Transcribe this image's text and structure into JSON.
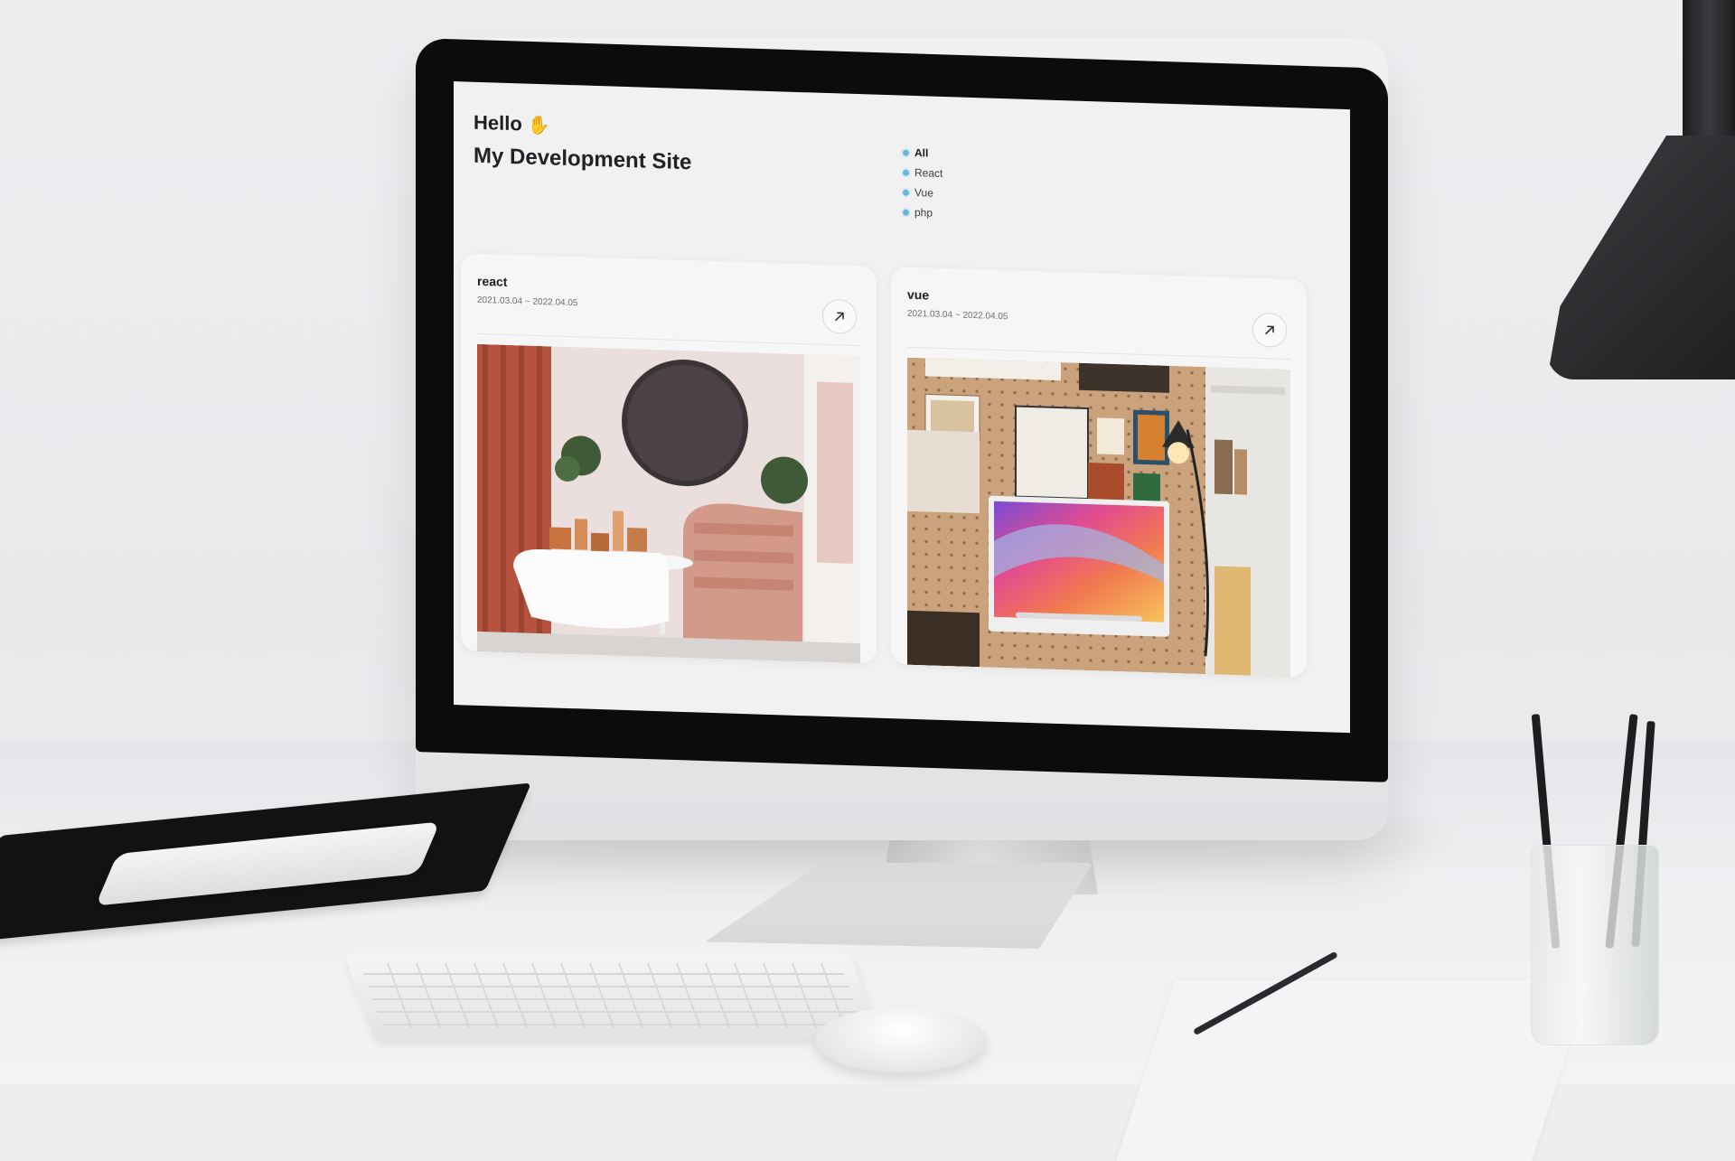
{
  "header": {
    "greeting": "Hello",
    "title": "My Development Site"
  },
  "filters": [
    {
      "label": "All",
      "active": true
    },
    {
      "label": "React",
      "active": false
    },
    {
      "label": "Vue",
      "active": false
    },
    {
      "label": "php",
      "active": false
    }
  ],
  "cards": [
    {
      "title": "react",
      "date": "2021.03.04 ~ 2022.04.05",
      "link_icon": "arrow-up-right-icon"
    },
    {
      "title": "vue",
      "date": "2021.03.04 ~ 2022.04.05",
      "link_icon": "arrow-up-right-icon"
    }
  ],
  "icons": {
    "greeting": "wave-hand-icon",
    "filter_bullet": "dot-icon"
  },
  "colors": {
    "accent": "#6bb6d6",
    "text": "#1e1e22",
    "screen_bg": "#f1f1f1"
  }
}
